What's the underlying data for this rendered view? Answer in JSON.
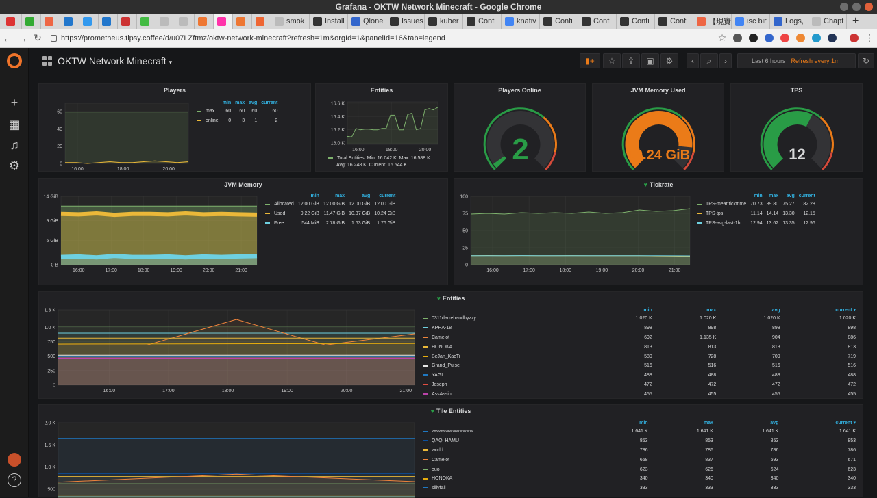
{
  "window": {
    "title": "Grafana - OKTW Network Minecraft - Google Chrome"
  },
  "tabs": [
    {
      "label": "",
      "color": "#d33"
    },
    {
      "label": "",
      "color": "#3a3"
    },
    {
      "label": "",
      "color": "#e64"
    },
    {
      "label": "",
      "color": "#27c"
    },
    {
      "label": "",
      "color": "#39e"
    },
    {
      "label": "",
      "color": "#27c"
    },
    {
      "label": "",
      "color": "#c33"
    },
    {
      "label": "",
      "color": "#4b4"
    },
    {
      "label": "",
      "color": "#bbb"
    },
    {
      "label": "",
      "color": "#bbb"
    },
    {
      "label": "",
      "color": "#e73"
    },
    {
      "label": "",
      "color": "#f3a"
    },
    {
      "label": "",
      "color": "#e73"
    },
    {
      "label": "",
      "color": "#e63"
    },
    {
      "label": "smok",
      "color": "#bbb"
    },
    {
      "label": "Install",
      "color": "#333"
    },
    {
      "label": "Qlone",
      "color": "#36c"
    },
    {
      "label": "Issues",
      "color": "#333"
    },
    {
      "label": "kuber",
      "color": "#333"
    },
    {
      "label": "Confi",
      "color": "#333"
    },
    {
      "label": "knativ",
      "color": "#4285f4"
    },
    {
      "label": "Confi",
      "color": "#333"
    },
    {
      "label": "Confi",
      "color": "#333"
    },
    {
      "label": "Confi",
      "color": "#333"
    },
    {
      "label": "Confi",
      "color": "#333"
    },
    {
      "label": "【現實",
      "color": "#e64"
    },
    {
      "label": "isc bir",
      "color": "#4285f4"
    },
    {
      "label": "Logs,",
      "color": "#36c"
    },
    {
      "label": "Chapt",
      "color": "#bbb"
    }
  ],
  "browser": {
    "url": "https://prometheus.tipsy.coffee/d/u07LZftmz/oktw-network-minecraft?refresh=1m&orgId=1&panelId=16&tab=legend",
    "new_tab": "+"
  },
  "icons": {
    "back": "arrow-left-icon",
    "forward": "arrow-right-icon",
    "reload": "reload-icon",
    "lock": "lock-icon",
    "star": "star-icon"
  },
  "dashboard": {
    "title": "OKTW Network Minecraft",
    "time_range": "Last 6 hours",
    "refresh": "Refresh every 1m"
  },
  "panels": {
    "players": {
      "title": "Players",
      "legend": {
        "headers": [
          "min",
          "max",
          "avg",
          "current"
        ],
        "rows": [
          {
            "name": "max",
            "color": "#7eb26d",
            "values": [
              "60",
              "60",
              "60",
              "60"
            ]
          },
          {
            "name": "online",
            "color": "#eab839",
            "values": [
              "0",
              "3",
              "1",
              "2"
            ]
          }
        ]
      }
    },
    "entities_small": {
      "title": "Entities",
      "legend": {
        "label": "Total Entities",
        "min": "Min: 16.042 K",
        "max": "Max: 16.588 K",
        "avg": "Avg: 16.248 K",
        "current": "Current: 16.544 K"
      }
    },
    "players_online": {
      "title": "Players Online",
      "value": "2",
      "fraction": 0.033,
      "color": "#299c46"
    },
    "jvm_used": {
      "title": "JVM Memory Used",
      "value": "10.24 GiB",
      "fraction": 0.853,
      "color": "#eb7b18"
    },
    "tps": {
      "title": "TPS",
      "value": "12",
      "fraction": 0.6,
      "color": "#d8d9da"
    },
    "jvm_memory": {
      "title": "JVM Memory",
      "legend": {
        "headers": [
          "min",
          "max",
          "avg",
          "current"
        ],
        "rows": [
          {
            "name": "Allocated",
            "color": "#7eb26d",
            "values": [
              "12.00 GiB",
              "12.00 GiB",
              "12.00 GiB",
              "12.00 GiB"
            ]
          },
          {
            "name": "Used",
            "color": "#eab839",
            "values": [
              "9.22 GiB",
              "11.47 GiB",
              "10.37 GiB",
              "10.24 GiB"
            ]
          },
          {
            "name": "Free",
            "color": "#6ed0e0",
            "values": [
              "544 MiB",
              "2.78 GiB",
              "1.63 GiB",
              "1.76 GiB"
            ]
          }
        ]
      }
    },
    "tickrate": {
      "title": "Tickrate",
      "legend": {
        "headers": [
          "min",
          "max",
          "avg",
          "current"
        ],
        "rows": [
          {
            "name": "TPS-meantickttime",
            "color": "#7eb26d",
            "values": [
              "70.73",
              "89.80",
              "75.27",
              "82.28"
            ]
          },
          {
            "name": "TPS-tps",
            "color": "#eab839",
            "values": [
              "11.14",
              "14.14",
              "13.30",
              "12.15"
            ]
          },
          {
            "name": "TPS-avg-last-1h",
            "color": "#6ed0e0",
            "values": [
              "12.94",
              "13.62",
              "13.35",
              "12.96"
            ]
          }
        ]
      }
    },
    "entities": {
      "title": "Entities",
      "legend": {
        "headers": [
          "min",
          "max",
          "avg",
          "current ▾"
        ],
        "rows": [
          {
            "name": "0311darrebandbyzzy",
            "color": "#7eb26d",
            "values": [
              "1.020 K",
              "1.020 K",
              "1.020 K",
              "1.020 K"
            ]
          },
          {
            "name": "KPHA-18",
            "color": "#6ed0e0",
            "values": [
              "898",
              "898",
              "898",
              "898"
            ]
          },
          {
            "name": "Camelot",
            "color": "#ef843c",
            "values": [
              "692",
              "1.135 K",
              "904",
              "886"
            ]
          },
          {
            "name": "HONOKA",
            "color": "#eab839",
            "values": [
              "813",
              "813",
              "813",
              "813"
            ]
          },
          {
            "name": "BeJan_KacTi",
            "color": "#e5ac0e",
            "values": [
              "580",
              "728",
              "709",
              "719"
            ]
          },
          {
            "name": "Grand_Pulse",
            "color": "#e5e5e5",
            "values": [
              "516",
              "516",
              "516",
              "516"
            ]
          },
          {
            "name": "YAGI",
            "color": "#1f78c1",
            "values": [
              "488",
              "488",
              "488",
              "488"
            ]
          },
          {
            "name": "Joseph",
            "color": "#e24d42",
            "values": [
              "472",
              "472",
              "472",
              "472"
            ]
          },
          {
            "name": "AssAssin",
            "color": "#ba43a9",
            "values": [
              "455",
              "455",
              "455",
              "455"
            ]
          }
        ]
      }
    },
    "tile_entities": {
      "title": "Tile Entities",
      "legend": {
        "headers": [
          "min",
          "max",
          "avg",
          "current ▾"
        ],
        "rows": [
          {
            "name": "wwwwwwwwwwww",
            "color": "#1f78c1",
            "values": [
              "1.641 K",
              "1.641 K",
              "1.641 K",
              "1.641 K"
            ]
          },
          {
            "name": "QAQ_HAMU",
            "color": "#0a50a1",
            "values": [
              "853",
              "853",
              "853",
              "853"
            ]
          },
          {
            "name": "world",
            "color": "#eab839",
            "values": [
              "786",
              "786",
              "786",
              "786"
            ]
          },
          {
            "name": "Camelot",
            "color": "#ef843c",
            "values": [
              "658",
              "837",
              "693",
              "671"
            ]
          },
          {
            "name": "ouo",
            "color": "#7eb26d",
            "values": [
              "623",
              "626",
              "624",
              "623"
            ]
          },
          {
            "name": "HONOKA",
            "color": "#e5ac0e",
            "values": [
              "340",
              "340",
              "340",
              "340"
            ]
          },
          {
            "name": "sillyfall",
            "color": "#1f78c1",
            "values": [
              "333",
              "333",
              "333",
              "333"
            ]
          }
        ]
      }
    }
  },
  "chart_data": [
    {
      "type": "line",
      "title": "Players",
      "x_ticks": [
        "16:00",
        "18:00",
        "20:00"
      ],
      "y_ticks": [
        "0",
        "20",
        "40",
        "60"
      ],
      "ylim": [
        0,
        70
      ],
      "series": [
        {
          "name": "max",
          "values": [
            60,
            60,
            60,
            60,
            60,
            60,
            60,
            60,
            60,
            60,
            60,
            60
          ]
        },
        {
          "name": "online",
          "values": [
            1,
            1,
            0,
            1,
            2,
            1,
            1,
            2,
            3,
            2,
            1,
            2
          ]
        }
      ]
    },
    {
      "type": "line",
      "title": "Entities",
      "x_ticks": [
        "16:00",
        "18:00",
        "20:00"
      ],
      "y_ticks": [
        "16.0 K",
        "16.2 K",
        "16.4 K",
        "16.6 K"
      ],
      "ylim": [
        15.98,
        16.62
      ],
      "series": [
        {
          "name": "Total Entities",
          "values": [
            16.1,
            16.09,
            16.22,
            16.2,
            16.21,
            16.21,
            16.2,
            16.2,
            16.22,
            16.22,
            16.42,
            16.42,
            16.2,
            16.2,
            16.43,
            16.45,
            16.2,
            16.22,
            16.5,
            16.52,
            16.5,
            16.54
          ]
        }
      ]
    },
    {
      "type": "gauge",
      "title": "Players Online",
      "value": 2
    },
    {
      "type": "gauge",
      "title": "JVM Memory Used",
      "value": "10.24 GiB"
    },
    {
      "type": "gauge",
      "title": "TPS",
      "value": 12
    },
    {
      "type": "area",
      "title": "JVM Memory",
      "x_ticks": [
        "16:00",
        "17:00",
        "18:00",
        "19:00",
        "20:00",
        "21:00"
      ],
      "y_ticks": [
        "0 B",
        "5 GiB",
        "9 GiB",
        "14 GiB"
      ],
      "ylim": [
        0,
        14
      ],
      "series": [
        {
          "name": "Allocated",
          "values": [
            12,
            12,
            12,
            12,
            12,
            12,
            12,
            12,
            12,
            12,
            12,
            12
          ]
        },
        {
          "name": "Used",
          "values": [
            10.4,
            10.3,
            10.5,
            10.2,
            10.4,
            10.4,
            10.3,
            10.5,
            10.3,
            10.4,
            10.3,
            10.24
          ]
        },
        {
          "name": "Free",
          "values": [
            1.6,
            1.7,
            1.5,
            1.8,
            1.6,
            1.6,
            1.7,
            1.5,
            1.7,
            1.6,
            1.7,
            1.76
          ]
        }
      ]
    },
    {
      "type": "line",
      "title": "Tickrate",
      "x_ticks": [
        "16:00",
        "17:00",
        "18:00",
        "19:00",
        "20:00",
        "21:00"
      ],
      "y_ticks": [
        "0",
        "25",
        "50",
        "75",
        "100"
      ],
      "ylim": [
        0,
        100
      ],
      "series": [
        {
          "name": "TPS-meantickttime",
          "values": [
            74,
            75,
            74,
            76,
            75,
            76,
            75,
            77,
            75,
            76,
            80,
            78,
            79,
            82
          ]
        },
        {
          "name": "TPS-tps",
          "values": [
            13.3,
            13.5,
            13.2,
            13.4,
            13.3,
            13.3,
            13.4,
            13.2,
            13.3,
            13.3,
            13.2,
            12.9,
            12.6,
            12.15
          ]
        },
        {
          "name": "TPS-avg-last-1h",
          "values": [
            13.3,
            13.35,
            13.3,
            13.4,
            13.35,
            13.35,
            13.3,
            13.35,
            13.35,
            13.3,
            13.3,
            13.2,
            13.1,
            12.96
          ]
        }
      ]
    },
    {
      "type": "area",
      "title": "Entities",
      "x_ticks": [
        "16:00",
        "17:00",
        "18:00",
        "19:00",
        "20:00",
        "21:00"
      ],
      "y_ticks": [
        "0",
        "250",
        "500",
        "750",
        "1.0 K",
        "1.3 K"
      ],
      "ylim": [
        0,
        1300
      ],
      "series": [
        {
          "name": "0311darrebandbyzzy",
          "values": [
            1020,
            1020
          ]
        },
        {
          "name": "KPHA-18",
          "values": [
            898,
            898
          ]
        },
        {
          "name": "Camelot",
          "values": [
            692,
            692,
            1135,
            692,
            886
          ]
        },
        {
          "name": "HONOKA",
          "values": [
            813,
            813
          ]
        },
        {
          "name": "BeJan_KacTi",
          "values": [
            709,
            719
          ]
        },
        {
          "name": "Grand_Pulse",
          "values": [
            516,
            516
          ]
        },
        {
          "name": "YAGI",
          "values": [
            488,
            488
          ]
        },
        {
          "name": "Joseph",
          "values": [
            472,
            472
          ]
        },
        {
          "name": "AssAssin",
          "values": [
            455,
            455
          ]
        }
      ]
    },
    {
      "type": "area",
      "title": "Tile Entities",
      "y_ticks": [
        "500",
        "1.0 K",
        "1.5 K",
        "2.0 K"
      ],
      "ylim": [
        300,
        2000
      ],
      "series": [
        {
          "name": "wwwwwwwwwwww",
          "values": [
            1641,
            1641
          ]
        },
        {
          "name": "QAQ_HAMU",
          "values": [
            853,
            853
          ]
        },
        {
          "name": "world",
          "values": [
            786,
            786
          ]
        },
        {
          "name": "Camelot",
          "values": [
            658,
            837,
            671
          ]
        },
        {
          "name": "ouo",
          "values": [
            623,
            623
          ]
        },
        {
          "name": "HONOKA",
          "values": [
            340,
            340
          ]
        },
        {
          "name": "sillyfall",
          "values": [
            333,
            333
          ]
        }
      ]
    }
  ]
}
